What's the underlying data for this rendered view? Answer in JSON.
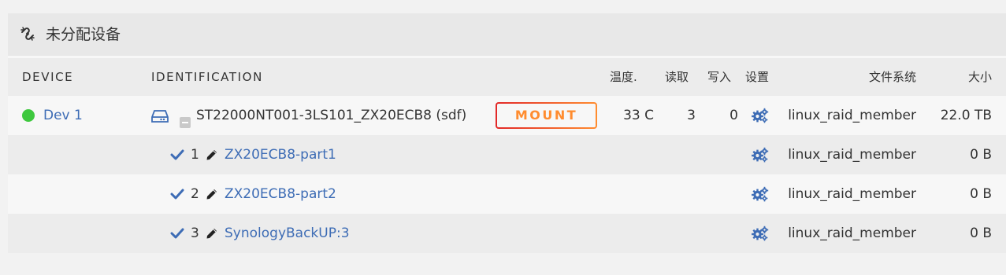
{
  "header": {
    "title": "未分配设备",
    "icon": "unlinked-chain-icon"
  },
  "columns": {
    "device": "DEVICE",
    "identification": "IDENTIFICATION",
    "temp": "温度.",
    "read": "读取",
    "write": "写入",
    "settings": "设置",
    "filesystem": "文件系统",
    "size": "大小"
  },
  "device": {
    "name": "Dev 1",
    "status_color": "#3ec83e",
    "identification": "ST22000NT001-3LS101_ZX20ECB8 (sdf)",
    "mount_label": "MOUNT",
    "temp": "33 C",
    "read": "3",
    "write": "0",
    "filesystem": "linux_raid_member",
    "size": "22.0 TB"
  },
  "partitions": [
    {
      "num": "1",
      "name": "ZX20ECB8-part1",
      "filesystem": "linux_raid_member",
      "size": "0 B"
    },
    {
      "num": "2",
      "name": "ZX20ECB8-part2",
      "filesystem": "linux_raid_member",
      "size": "0 B"
    },
    {
      "num": "3",
      "name": "SynologyBackUP:3",
      "filesystem": "linux_raid_member",
      "size": "0 B"
    }
  ],
  "colors": {
    "link": "#3d6cb5",
    "status_green": "#3ec83e",
    "mount_gradient_start": "#e22828",
    "mount_gradient_end": "#ff8c2f"
  }
}
